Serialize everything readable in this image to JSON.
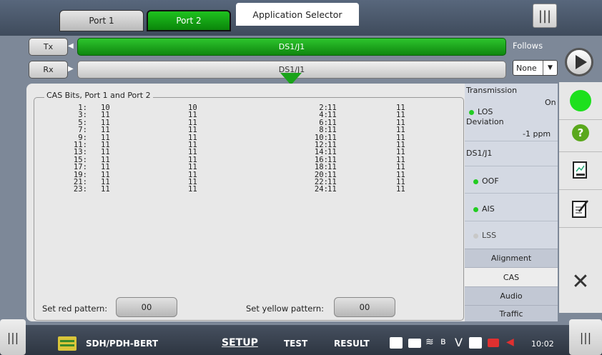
{
  "header": {
    "port_tabs": [
      "Port 1",
      "Port 2"
    ],
    "app_selector": "Application Selector",
    "menu_glyph": "|||"
  },
  "signal": {
    "tx_label": "Tx",
    "rx_label": "Rx",
    "tx_value": "DS1/J1",
    "rx_value": "DS1/J1",
    "follows_label": "Follows",
    "follows_value": "None"
  },
  "cas": {
    "title": "CAS Bits, Port 1 and Port 2",
    "rows": [
      {
        "a": "1:",
        "b": "10",
        "c": "10",
        "d": "2:",
        "e": "11",
        "f": "11"
      },
      {
        "a": "3:",
        "b": "11",
        "c": "11",
        "d": "4:",
        "e": "11",
        "f": "11"
      },
      {
        "a": "5:",
        "b": "11",
        "c": "11",
        "d": "6:",
        "e": "11",
        "f": "11"
      },
      {
        "a": "7:",
        "b": "11",
        "c": "11",
        "d": "8:",
        "e": "11",
        "f": "11"
      },
      {
        "a": "9:",
        "b": "11",
        "c": "11",
        "d": "10:",
        "e": "11",
        "f": "11"
      },
      {
        "a": "11:",
        "b": "11",
        "c": "11",
        "d": "12:",
        "e": "11",
        "f": "11"
      },
      {
        "a": "13:",
        "b": "11",
        "c": "11",
        "d": "14:",
        "e": "11",
        "f": "11"
      },
      {
        "a": "15:",
        "b": "11",
        "c": "11",
        "d": "16:",
        "e": "11",
        "f": "11"
      },
      {
        "a": "17:",
        "b": "11",
        "c": "11",
        "d": "18:",
        "e": "11",
        "f": "11"
      },
      {
        "a": "19:",
        "b": "11",
        "c": "11",
        "d": "20:",
        "e": "11",
        "f": "11"
      },
      {
        "a": "21:",
        "b": "11",
        "c": "11",
        "d": "22:",
        "e": "11",
        "f": "11"
      },
      {
        "a": "23:",
        "b": "11",
        "c": "11",
        "d": "24:",
        "e": "11",
        "f": "11"
      }
    ],
    "red_label": "Set red pattern:",
    "red_value": "00",
    "yellow_label": "Set yellow pattern:",
    "yellow_value": "00"
  },
  "status": {
    "transmission_label": "Transmission",
    "transmission_value": "On",
    "los_label": "LOS",
    "deviation_label": "Deviation",
    "deviation_value": "-1 ppm",
    "section_label": "DS1/J1",
    "oof_label": "OOF",
    "ais_label": "AIS",
    "lss_label": "LSS",
    "led_green": "#22cc22",
    "led_grey": "#c8c8c8"
  },
  "nav": {
    "items": [
      "Alignment",
      "CAS",
      "Audio",
      "Traffic"
    ],
    "active": "CAS"
  },
  "rightbar": {
    "icons": [
      "play-icon",
      "status-led-icon",
      "help-icon",
      "report-icon",
      "notes-icon",
      "close-icon"
    ],
    "help_glyph": "?",
    "close_glyph": "✕"
  },
  "bottombar": {
    "app_name": "SDH/PDH-BERT",
    "tabs": [
      "SETUP",
      "TEST",
      "RESULT"
    ],
    "active_tab": "SETUP",
    "time": "10:02",
    "v_glyph": "V"
  }
}
